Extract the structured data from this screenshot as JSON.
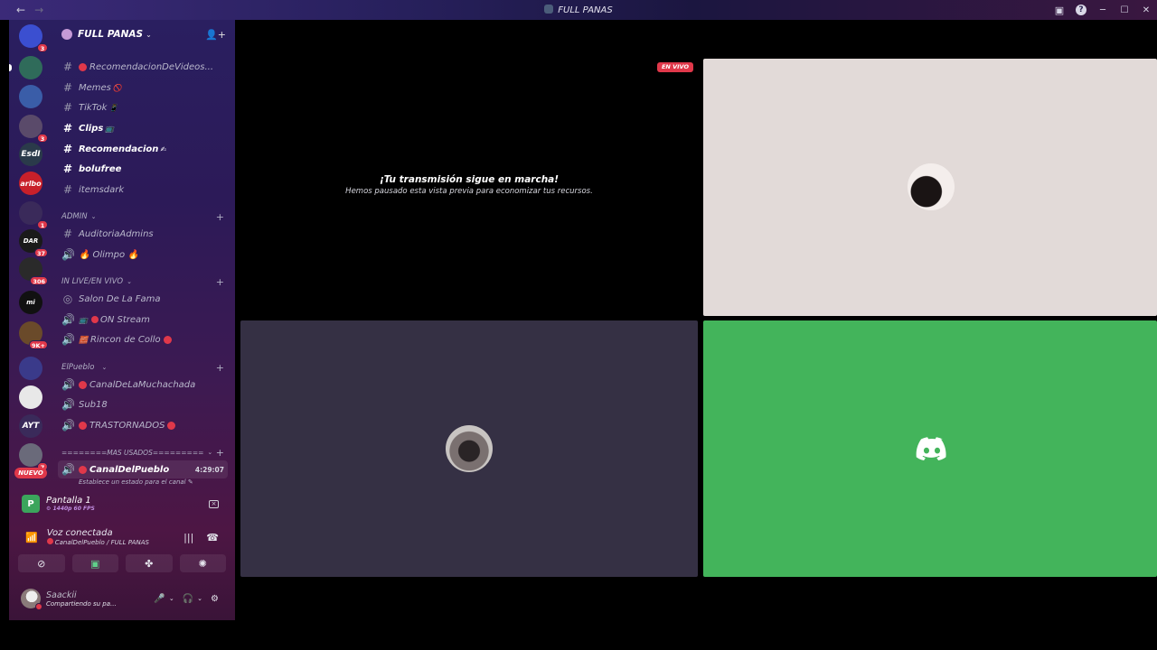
{
  "titlebar": {
    "title": "FULL PANAS",
    "back": "←",
    "forward": "→",
    "help": "?"
  },
  "server": {
    "name": "FULL PANAS"
  },
  "guilds": [
    {
      "label": "",
      "color": "#3b4fd0",
      "badge": "3"
    },
    {
      "label": "",
      "color": "#2f6b5a",
      "badge": ""
    },
    {
      "label": "",
      "color": "#3a5da8",
      "badge": ""
    },
    {
      "label": "",
      "color": "#5a4a6a",
      "badge": "3"
    },
    {
      "label": "EsdI",
      "color": "#2a3a4a",
      "badge": ""
    },
    {
      "label": "arlbo",
      "color": "#c8202a",
      "badge": ""
    },
    {
      "label": "",
      "color": "#3a2a5a",
      "badge": "1"
    },
    {
      "label": "DAR",
      "color": "#1a1a1a",
      "badge": "37"
    },
    {
      "label": "",
      "color": "#2a2a2a",
      "badge": "306"
    },
    {
      "label": "mi",
      "color": "#111111",
      "badge": ""
    },
    {
      "label": "",
      "color": "#6a4a2a",
      "badge": "9K+"
    },
    {
      "label": "",
      "color": "#3a3a8a",
      "badge": ""
    },
    {
      "label": "",
      "color": "#e8e8e8",
      "badge": ""
    },
    {
      "label": "AYT",
      "color": "#3a2a5a",
      "badge": ""
    },
    {
      "label": "",
      "color": "#6a6a7a",
      "badge": "7"
    }
  ],
  "nuevo": "NUEVO",
  "channels": {
    "top": [
      {
        "name": "RecomendacionDeVideos...",
        "type": "text",
        "bold": false,
        "nobadge": true
      },
      {
        "name": "Memes",
        "type": "text",
        "bold": false,
        "suffix": "🚫"
      },
      {
        "name": "TikTok",
        "type": "text",
        "bold": false,
        "suffix": "📱"
      },
      {
        "name": "Clips",
        "type": "text",
        "bold": true,
        "suffix": "📺"
      },
      {
        "name": "Recomendacion",
        "type": "text",
        "bold": true,
        "suffix": "✍"
      },
      {
        "name": "bolufree",
        "type": "text",
        "bold": true
      },
      {
        "name": "itemsdark",
        "type": "text",
        "bold": false
      }
    ],
    "admin_cat": "ADMIN",
    "admin": [
      {
        "name": "AuditoriaAdmins",
        "type": "text"
      },
      {
        "name": "Olimpo",
        "type": "voice"
      }
    ],
    "live_cat": "IN LIVE/EN VIVO",
    "live": [
      {
        "name": "Salon De La Fama",
        "type": "stage"
      },
      {
        "name": "ON Stream",
        "type": "voice"
      },
      {
        "name": "Rincon de Collo",
        "type": "voice"
      }
    ],
    "pueblo_cat": "ElPueblo",
    "pueblo": [
      {
        "name": "CanalDeLaMuchachada",
        "type": "voice"
      },
      {
        "name": "Sub18",
        "type": "voice"
      },
      {
        "name": "TRASTORNADOS",
        "type": "voice"
      }
    ],
    "mas_cat": "========MAS USADOS=========",
    "active": {
      "name": "CanalDelPueblo",
      "time": "4:29:07",
      "sub": "Establece un estado para el canal"
    }
  },
  "stream_panel": {
    "title": "Pantalla 1",
    "quality": "1440p 60 FPS"
  },
  "voice_panel": {
    "status": "Voz conectada",
    "location": "CanalDelPueblo / FULL PANAS"
  },
  "user_panel": {
    "name": "Saackii",
    "status": "Compartiendo su pa..."
  },
  "stage": {
    "live_badge": "EN VIVO",
    "paused_title": "¡Tu transmisión sigue en marcha!",
    "paused_sub": "Hemos pausado esta vista previa para economizar tus recursos."
  }
}
